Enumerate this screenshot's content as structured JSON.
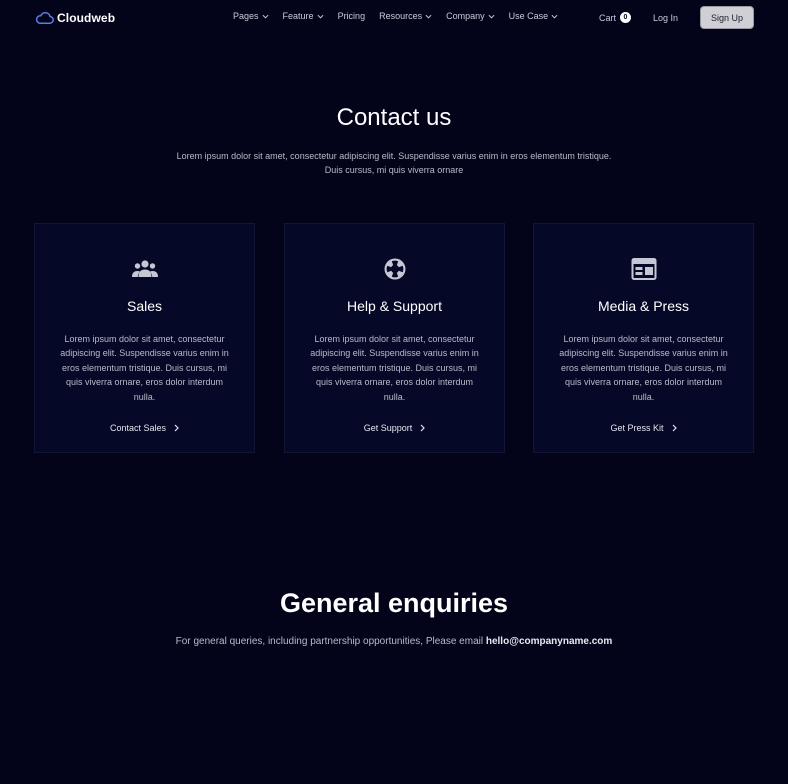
{
  "brand": {
    "name": "Cloudweb",
    "logo_icon": "cloud-icon",
    "accent": "#5b7ce6"
  },
  "nav": {
    "items": [
      {
        "label": "Pages",
        "dropdown": true
      },
      {
        "label": "Feature",
        "dropdown": true
      },
      {
        "label": "Pricing",
        "dropdown": false
      },
      {
        "label": "Resources",
        "dropdown": true
      },
      {
        "label": "Company",
        "dropdown": true
      },
      {
        "label": "Use Case",
        "dropdown": true
      }
    ],
    "cart_label": "Cart",
    "cart_count": "0",
    "login_label": "Log In",
    "signup_label": "Sign Up"
  },
  "hero": {
    "title": "Contact us",
    "subtitle_line1": "Lorem ipsum dolor sit amet, consectetur adipiscing elit. Suspendisse varius enim in eros elementum tristique.",
    "subtitle_line2": "Duis cursus, mi quis viverra ornare"
  },
  "cards": [
    {
      "icon": "users-icon",
      "title": "Sales",
      "description": "Lorem ipsum dolor sit amet, consectetur adipiscing elit. Suspendisse varius enim in eros elementum tristique. Duis cursus, mi quis viverra ornare, eros dolor interdum nulla.",
      "link": "Contact Sales"
    },
    {
      "icon": "lifebuoy-icon",
      "title": "Help & Support",
      "description": "Lorem ipsum dolor sit amet, consectetur adipiscing elit. Suspendisse varius enim in eros elementum tristique. Duis cursus, mi quis viverra ornare, eros dolor interdum nulla.",
      "link": "Get Support"
    },
    {
      "icon": "newspaper-icon",
      "title": "Media & Press",
      "description": "Lorem ipsum dolor sit amet, consectetur adipiscing elit. Suspendisse varius enim in eros elementum tristique. Duis cursus, mi quis viverra ornare, eros dolor interdum nulla.",
      "link": "Get Press Kit"
    }
  ],
  "enquiries": {
    "title": "General enquiries",
    "text": "For general queries, including partnership opportunities, Please email ",
    "email": "hello@companyname.com"
  }
}
